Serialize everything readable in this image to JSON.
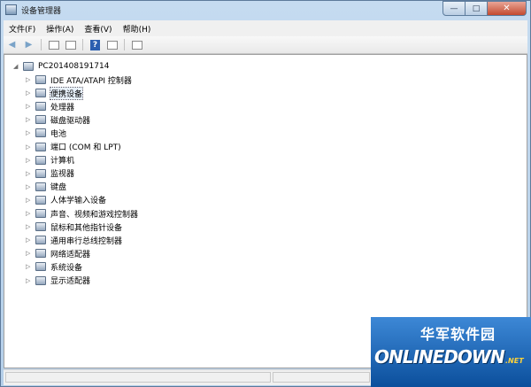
{
  "window": {
    "title": "设备管理器"
  },
  "window_buttons": {
    "minimize": "—",
    "maximize": "□",
    "close": "✕"
  },
  "menu": [
    {
      "label": "文件(F)"
    },
    {
      "label": "操作(A)"
    },
    {
      "label": "查看(V)"
    },
    {
      "label": "帮助(H)"
    }
  ],
  "toolbar": {
    "back_icon": "arrow-left-icon",
    "forward_icon": "arrow-right-icon",
    "help_glyph": "?"
  },
  "tree": {
    "root": "PC201408191714",
    "root_expander": "◢",
    "expander_glyph": "▷",
    "items": [
      {
        "label": "IDE ATA/ATAPI 控制器",
        "icon": "ide-controller-icon"
      },
      {
        "label": "便携设备",
        "icon": "portable-device-icon",
        "selected": true
      },
      {
        "label": "处理器",
        "icon": "processor-icon"
      },
      {
        "label": "磁盘驱动器",
        "icon": "disk-drive-icon"
      },
      {
        "label": "电池",
        "icon": "battery-icon"
      },
      {
        "label": "端口 (COM 和 LPT)",
        "icon": "port-icon"
      },
      {
        "label": "计算机",
        "icon": "computer-icon"
      },
      {
        "label": "监视器",
        "icon": "monitor-icon"
      },
      {
        "label": "键盘",
        "icon": "keyboard-icon"
      },
      {
        "label": "人体学输入设备",
        "icon": "hid-icon"
      },
      {
        "label": "声音、视频和游戏控制器",
        "icon": "sound-icon"
      },
      {
        "label": "鼠标和其他指针设备",
        "icon": "mouse-icon"
      },
      {
        "label": "通用串行总线控制器",
        "icon": "usb-icon"
      },
      {
        "label": "网络适配器",
        "icon": "network-adapter-icon"
      },
      {
        "label": "系统设备",
        "icon": "system-device-icon"
      },
      {
        "label": "显示适配器",
        "icon": "display-adapter-icon"
      }
    ]
  },
  "watermark": {
    "cn": "华军软件园",
    "en": "ONLINEDOWN",
    "net": ".NET"
  }
}
